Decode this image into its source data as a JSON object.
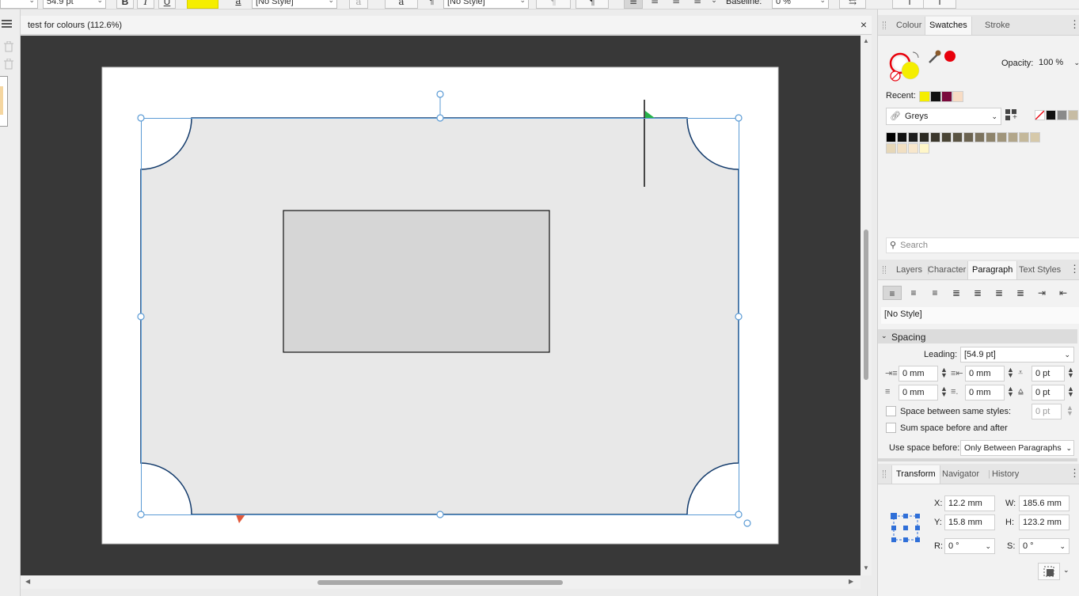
{
  "toolbar": {
    "font_size": "54.9 pt",
    "bold": "B",
    "italic": "I",
    "underline": "U",
    "char_style": "[No Style]",
    "para_style": "[No Style]",
    "baseline_label": "Baseline:",
    "baseline_value": "0 %",
    "highlight_color": "#f5ee00"
  },
  "document": {
    "title": "test for colours (112.6%)",
    "close": "×"
  },
  "swatches_panel": {
    "tabs": [
      "Colour",
      "Swatches",
      "Stroke"
    ],
    "active_tab": "Swatches",
    "opacity_label": "Opacity:",
    "opacity_value": "100 %",
    "recent_label": "Recent:",
    "recent_colors": [
      "#f5ee00",
      "#111111",
      "#7a0a3c",
      "#f8dcc4"
    ],
    "palette_name": "Greys",
    "search_placeholder": "Search",
    "fill_color": "#f5ee00",
    "stroke_dot_color": "#e8000b",
    "palette_row1": [
      "#000000",
      "#111111",
      "#1e1e1e",
      "#2c2a22",
      "#3b372c",
      "#4a4535",
      "#5a5443",
      "#6b6350",
      "#7c735e",
      "#8e846c",
      "#a0957b",
      "#b2a68a",
      "#c4b89a",
      "#d6c9aa"
    ],
    "palette_row2": [
      "#e6d7b8",
      "#f1dfc2",
      "#f8e7cc",
      "#fff6c8"
    ],
    "mini_swatches": [
      "#111111",
      "#8a8a8a",
      "#c7bca4",
      "#fffacc"
    ]
  },
  "paragraph_panel": {
    "tabs": [
      "Layers",
      "Character",
      "Paragraph",
      "Text Styles"
    ],
    "active_tab": "Paragraph",
    "style": "[No Style]",
    "section": "Spacing",
    "leading_label": "Leading:",
    "leading_value": "[54.9 pt]",
    "left_indent": "0 mm",
    "first_indent": "0 mm",
    "space_before": "0 pt",
    "right_indent": "0 mm",
    "last_indent": "0 mm",
    "space_after": "0 pt",
    "same_styles_label": "Space between same styles:",
    "same_styles_value": "0 pt",
    "sum_label": "Sum space before and after",
    "use_space_label": "Use space before:",
    "use_space_value": "Only Between Paragraphs"
  },
  "transform_panel": {
    "tabs": [
      "Transform",
      "Navigator",
      "History"
    ],
    "active_tab": "Transform",
    "x_label": "X:",
    "x_value": "12.2 mm",
    "y_label": "Y:",
    "y_value": "15.8 mm",
    "w_label": "W:",
    "w_value": "185.6 mm",
    "h_label": "H:",
    "h_value": "123.2 mm",
    "r_label": "R:",
    "r_value": "0 °",
    "s_label": "S:",
    "s_value": "0 °"
  },
  "colors": {
    "pasteboard": "#383838",
    "selection": "#5b9bd5",
    "shape_fill": "#e8e8e8",
    "shape_stroke": "#123a6b",
    "inner_rect_fill": "#d6d6d6"
  }
}
